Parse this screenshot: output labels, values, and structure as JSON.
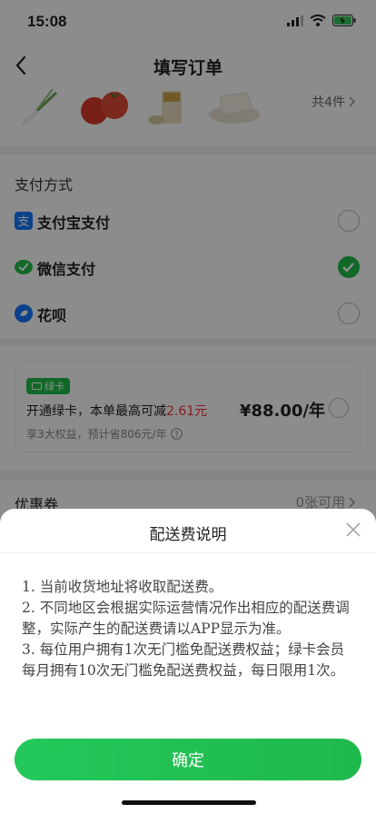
{
  "status": {
    "time": "15:08"
  },
  "nav": {
    "title": "填写订单"
  },
  "products": {
    "count_label": "共4件"
  },
  "payment": {
    "title": "支付方式",
    "options": [
      {
        "label": "支付宝支付",
        "icon": "alipay-icon",
        "selected": false
      },
      {
        "label": "微信支付",
        "icon": "wechat-pay-icon",
        "selected": true
      },
      {
        "label": "花呗",
        "icon": "huabei-icon",
        "selected": false
      }
    ]
  },
  "green_card": {
    "badge": "绿卡",
    "text_prefix": "开通绿卡，本单最高可减",
    "discount": "2.61元",
    "price": "¥88.00/年",
    "sub": "享3大权益，预计省806元/年"
  },
  "coupon": {
    "label": "优惠券",
    "value": "0张可用"
  },
  "sheet": {
    "title": "配送费说明",
    "lines": [
      "1. 当前收货地址将收取配送费。",
      "2. 不同地区会根据实际运营情况作出相应的配送费调整，实际产生的配送费请以APP显示为准。",
      "3. 每位用户拥有1次无门槛免配送费权益；绿卡会员每月拥有10次无门槛免配送费权益，每日限用1次。"
    ],
    "confirm": "确定"
  },
  "colors": {
    "accent": "#1fbe4a",
    "discount": "#e33333"
  }
}
